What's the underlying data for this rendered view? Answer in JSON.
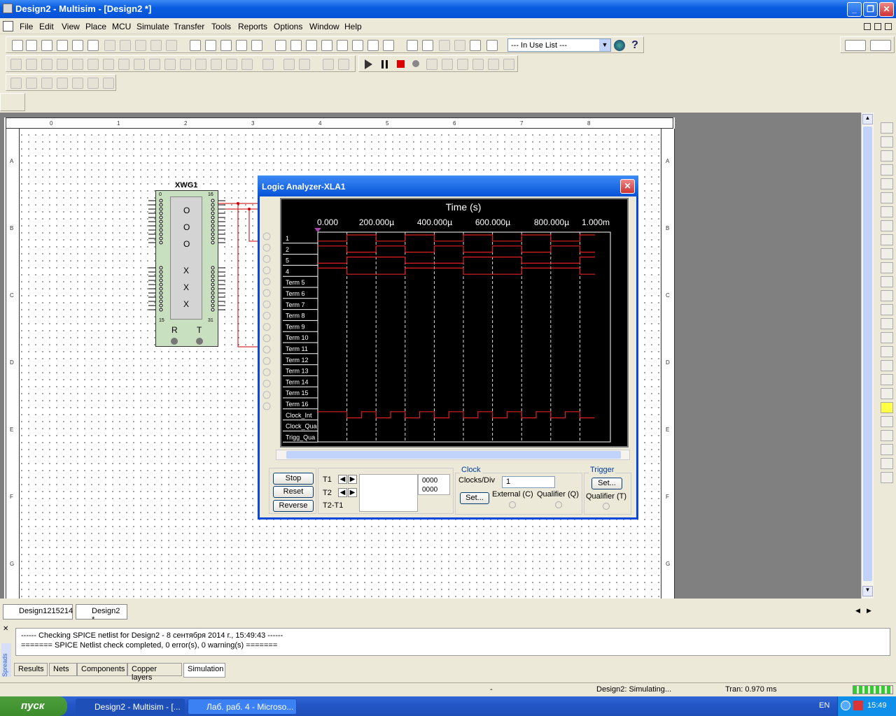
{
  "window": {
    "title": "Design2 - Multisim - [Design2 *]",
    "min": "_",
    "max": "❐",
    "close": "✕"
  },
  "menu": [
    "File",
    "Edit",
    "View",
    "Place",
    "MCU",
    "Simulate",
    "Transfer",
    "Tools",
    "Reports",
    "Options",
    "Window",
    "Help"
  ],
  "inuse": {
    "value": "--- In Use List ---"
  },
  "ruler": {
    "cols": [
      "0",
      "1",
      "2",
      "3",
      "4",
      "5",
      "6",
      "7",
      "8"
    ],
    "rows": [
      "A",
      "B",
      "C",
      "D",
      "E",
      "F",
      "G"
    ]
  },
  "xwg": {
    "name": "XWG1",
    "left_top": "0",
    "right_top": "16",
    "left_bot": "15",
    "right_bot": "31",
    "cells": [
      "O",
      "O",
      "O",
      "X",
      "X",
      "X"
    ],
    "r": "R",
    "t": "T"
  },
  "analyzer": {
    "title": "Logic Analyzer-XLA1",
    "time_label": "Time (s)",
    "ticks": [
      "0.000",
      "200.000µ",
      "400.000µ",
      "600.000µ",
      "800.000µ",
      "1.000m"
    ],
    "channels": [
      "1",
      "2",
      "5",
      "4",
      "Term 5",
      "Term 6",
      "Term 7",
      "Term 8",
      "Term 9",
      "Term 10",
      "Term 11",
      "Term 12",
      "Term 13",
      "Term 14",
      "Term 15",
      "Term 16",
      "Clock_Int",
      "Clock_Qua",
      "Trigg_Qua"
    ],
    "buttons": {
      "stop": "Stop",
      "reset": "Reset",
      "reverse": "Reverse"
    },
    "t1": "T1",
    "t2": "T2",
    "t2t1": "T2-T1",
    "val1": "0000",
    "val2": "0000",
    "clock": {
      "group": "Clock",
      "cpd_label": "Clocks/Div",
      "cpd_value": "1",
      "set": "Set...",
      "external": "External (C)",
      "qualifier": "Qualifier (Q)"
    },
    "trigger": {
      "group": "Trigger",
      "set": "Set...",
      "qualifier": "Qualifier (T)"
    }
  },
  "tabs": [
    "Design1215214",
    "Design2 *"
  ],
  "log": {
    "lines": [
      "------ Checking SPICE netlist for Design2 - 8 сентября 2014 г., 15:49:43 ------",
      "======= SPICE Netlist check completed, 0 error(s), 0 warning(s) ======="
    ],
    "side": "Spreads",
    "tabs": [
      "Results",
      "Nets",
      "Components",
      "Copper layers",
      "Simulation"
    ]
  },
  "status": {
    "dash": "-",
    "sim": "Design2: Simulating...",
    "tran": "Tran: 0.970 ms"
  },
  "taskbar": {
    "start": "пуск",
    "tasks": [
      "Design2 - Multisim - [...",
      "Лаб. раб. 4 - Microso..."
    ],
    "lang": "EN",
    "clock": "15:49"
  }
}
